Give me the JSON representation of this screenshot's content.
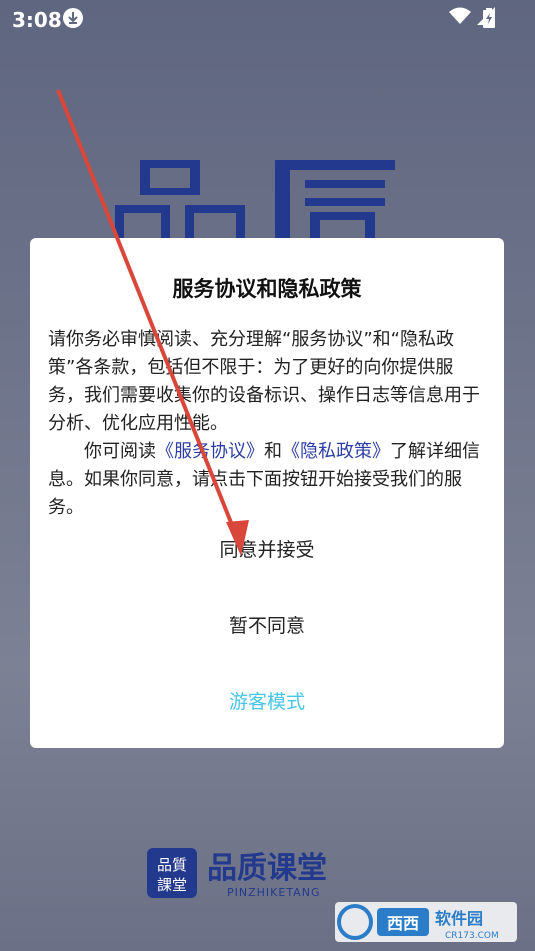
{
  "status_bar": {
    "time": "3:08"
  },
  "dialog": {
    "title": "服务协议和隐私政策",
    "para1": "请你务必审慎阅读、充分理解“服务协议”和“隐私政策”各条款，包括但不限于：为了更好的向你提供服务，我们需要收集你的设备标识、操作日志等信息用于分析、优化应用性能。",
    "para2_prefix": "你可阅读",
    "link_service": "《服务协议》",
    "para2_and": "和",
    "link_privacy": "《隐私政策》",
    "para2_suffix": "了解详细信息。如果你同意，请点击下面按钮开始接受我们的服务。",
    "btn_agree": "同意并接受",
    "btn_decline": "暂不同意",
    "btn_guest": "游客模式"
  },
  "brand": {
    "logo_text": "品质课堂",
    "small_logo_text": "品質課堂",
    "logo_pinyin": "PINZHIKETANG"
  },
  "watermark": {
    "text": "西西软件园",
    "url": "CR173.COM"
  },
  "colors": {
    "link": "#2c3ea6",
    "guest": "#47c6e8",
    "arrow": "#d9473a",
    "brand_blue": "#23398d"
  }
}
